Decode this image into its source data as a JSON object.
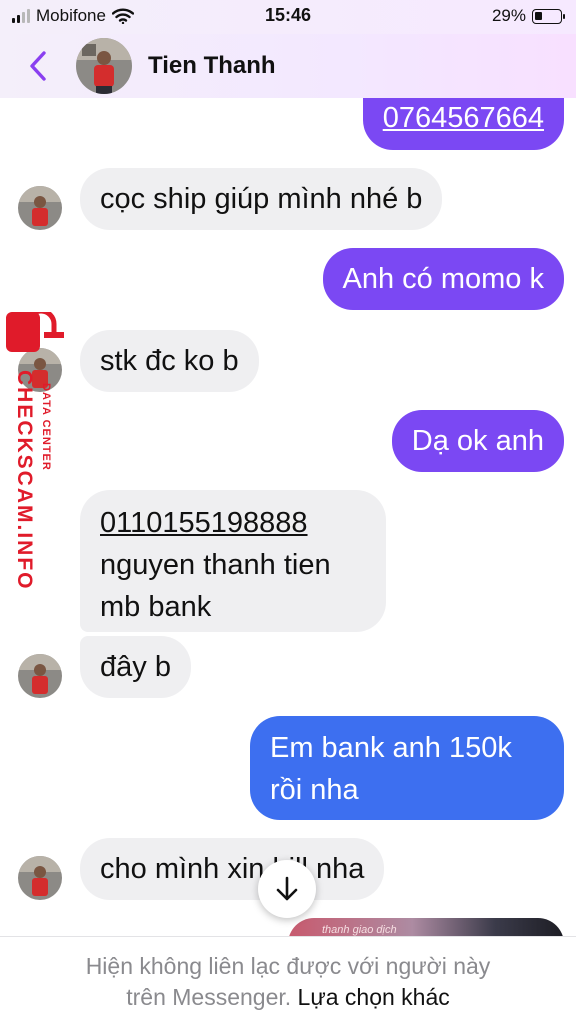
{
  "status": {
    "carrier": "Mobifone",
    "time": "15:46",
    "battery": "29%",
    "battery_level": 0.29
  },
  "header": {
    "contact_name": "Tien Thanh"
  },
  "messages": [
    {
      "from": "me",
      "text": "0764567664"
    },
    {
      "from": "contact",
      "text": "cọc ship giúp mình nhé b"
    },
    {
      "from": "me",
      "text": "Anh có momo k"
    },
    {
      "from": "contact",
      "text": "stk đc ko b"
    },
    {
      "from": "me",
      "text": "Dạ ok anh"
    },
    {
      "from": "contact",
      "lines": [
        "0110155198888",
        "nguyen thanh tien",
        "mb bank"
      ]
    },
    {
      "from": "contact",
      "text": "đây b"
    },
    {
      "from": "me",
      "lines": [
        "Em bank anh 150k",
        "rồi nha"
      ]
    },
    {
      "from": "contact",
      "text": "cho mình xin bill nha"
    }
  ],
  "media_preview_caption": "thanh giao dịch",
  "footer": {
    "notice": "Hiện không liên lạc được với người này",
    "notice_2": "trên Messenger.",
    "link": "Lựa chọn khác"
  },
  "watermark": {
    "main": "CHECKSCAM.INFO",
    "sub": "DATA CENTER"
  },
  "colors": {
    "outgoing_purple": "#7b48f3",
    "outgoing_blue": "#3d6ff0",
    "incoming": "#efeff1",
    "accent": "#8a3ff0",
    "watermark_red": "#e01b2a"
  },
  "icons": {
    "back": "chevron-left-icon",
    "scroll": "arrow-down-icon",
    "wifi": "wifi-icon",
    "battery": "battery-icon",
    "signal": "signal-icon",
    "lock": "lock-icon"
  }
}
